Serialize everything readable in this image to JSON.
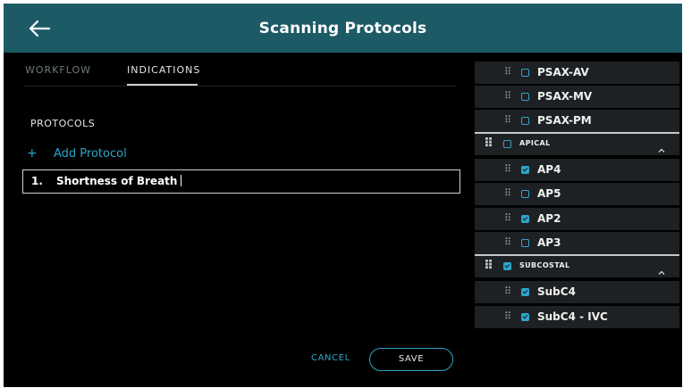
{
  "header": {
    "title": "Scanning Protocols",
    "back_icon": "back-arrow-icon"
  },
  "tabs": [
    {
      "label": "WORKFLOW",
      "active": false
    },
    {
      "label": "INDICATIONS",
      "active": true
    }
  ],
  "protocols": {
    "section_label": "PROTOCOLS",
    "add_label": "Add Protocol",
    "add_icon": "+",
    "items": [
      {
        "number": "1.",
        "value": "Shortness of Breath"
      }
    ]
  },
  "actions": {
    "cancel": "CANCEL",
    "save": "SAVE"
  },
  "views": {
    "parasternal_tail": [
      {
        "label": "PSAX-AV",
        "checked": false
      },
      {
        "label": "PSAX-MV",
        "checked": false
      },
      {
        "label": "PSAX-PM",
        "checked": false
      }
    ],
    "groups": [
      {
        "label": "APICAL",
        "checked": false,
        "expanded": true,
        "items": [
          {
            "label": "AP4",
            "checked": true
          },
          {
            "label": "AP5",
            "checked": false
          },
          {
            "label": "AP2",
            "checked": true
          },
          {
            "label": "AP3",
            "checked": false
          }
        ]
      },
      {
        "label": "SUBCOSTAL",
        "checked": true,
        "expanded": true,
        "items": [
          {
            "label": "SubC4",
            "checked": true
          },
          {
            "label": "SubC4 - IVC",
            "checked": true
          }
        ]
      }
    ]
  },
  "colors": {
    "header": "#1c5a66",
    "accent": "#2fa3c8",
    "row": "#1e2123",
    "background": "#000000"
  }
}
